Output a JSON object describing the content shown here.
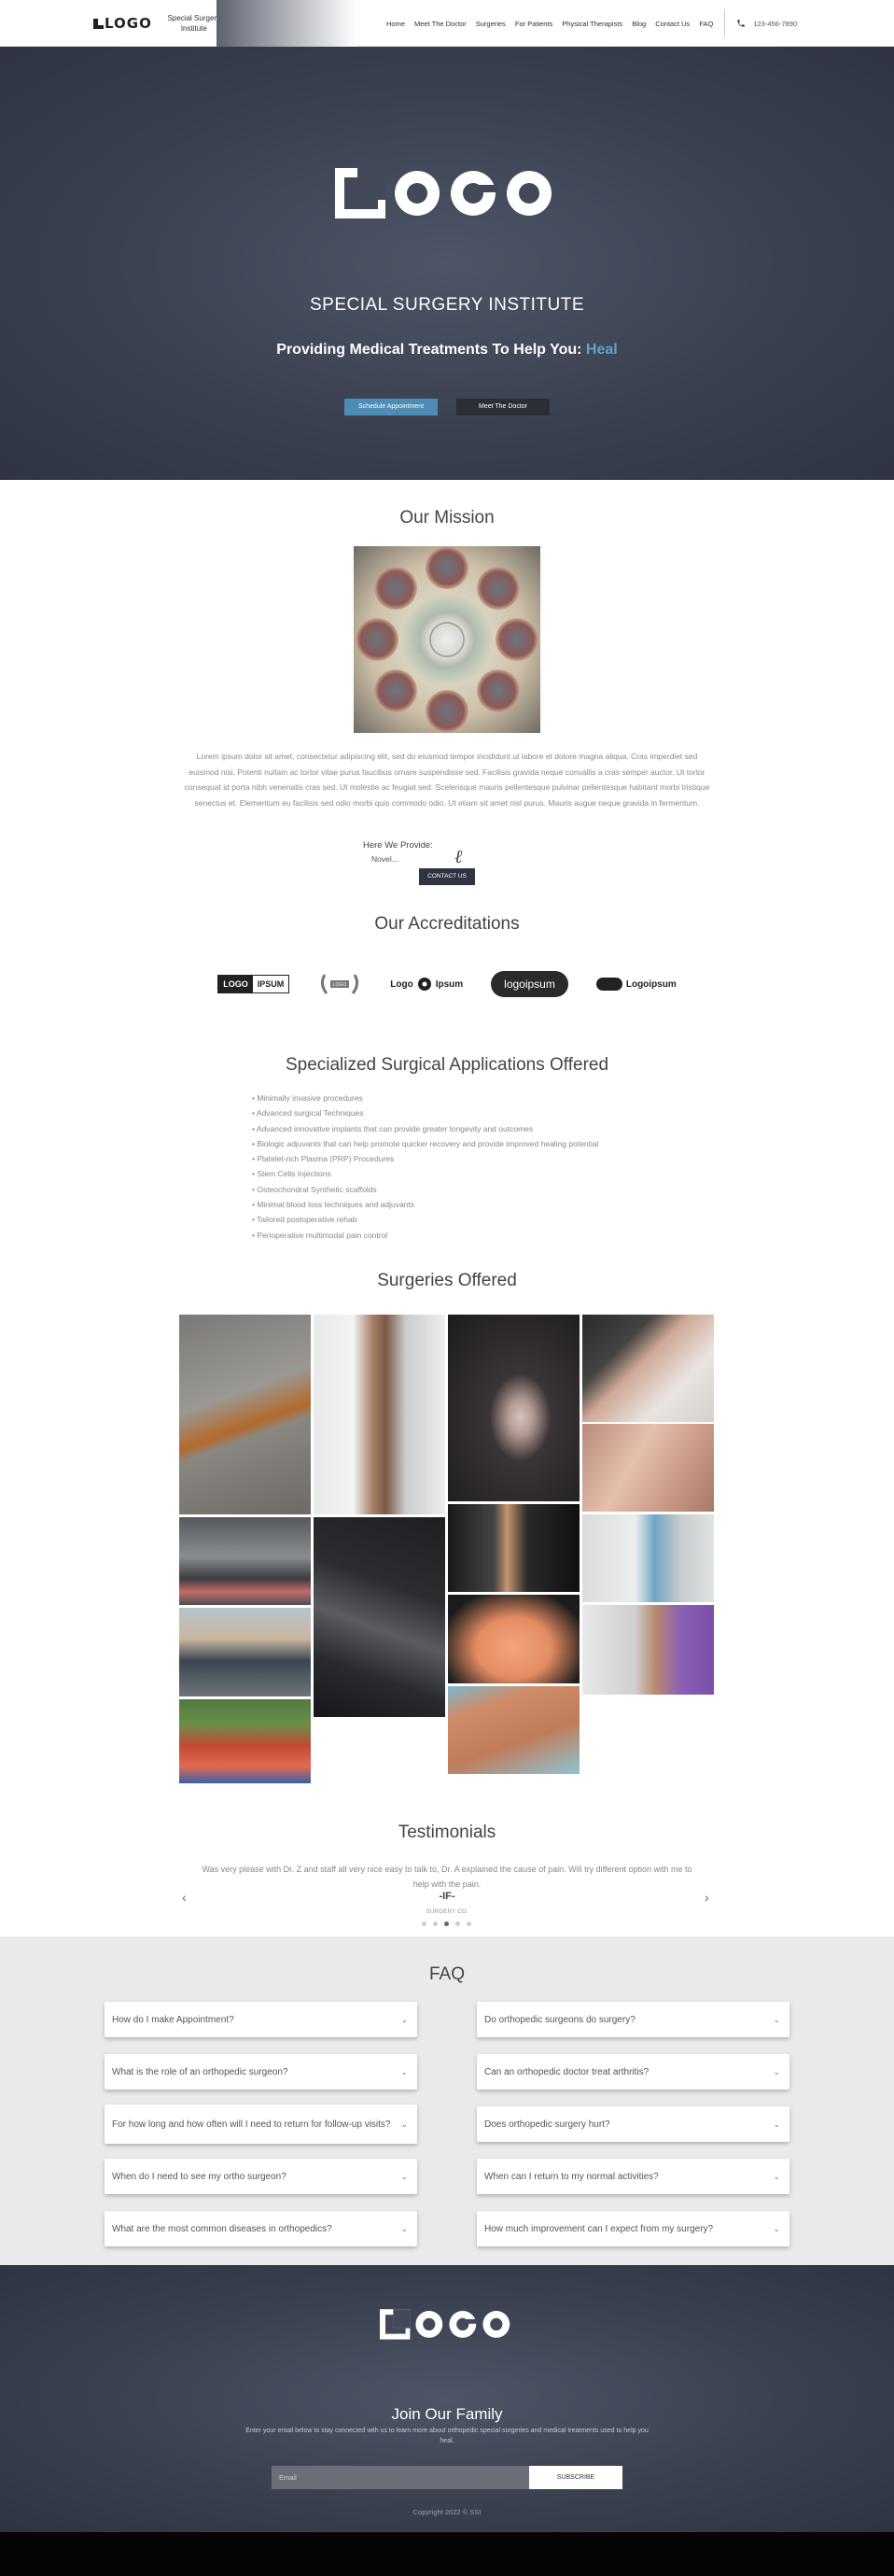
{
  "header": {
    "logo": "LOGO",
    "site_title": "Special Surgery Institute",
    "nav": [
      "Home",
      "Meet The Doctor",
      "Surgeries",
      "For Patients",
      "Physical Therapists",
      "Blog",
      "Contact Us",
      "FAQ"
    ],
    "phone": "123-456-7890"
  },
  "hero": {
    "logo": "LOGO",
    "title": "SPECIAL SURGERY INSTITUTE",
    "subtitle": "Providing Medical Treatments To Help You:",
    "highlight": "Heal",
    "btn_primary": "Schedule Appointment",
    "btn_secondary": "Meet The Doctor"
  },
  "mission": {
    "title": "Our Mission",
    "body": "Lorem ipsum dolor sit amet, consectetur adipiscing elit, sed do eiusmod tempor incididunt ut labore et dolore magna aliqua. Cras imperdiet sed euismod nisi. Potenti nullam ac tortor vitae purus faucibus ornare suspendisse sed. Facilisis gravida neque convallis a cras semper auctor. Ut tortor consequat id porta nibh venenatis cras sed. Ut molestie ac feugiat sed. Scelerisque mauris pellentesque pulvinar pellentesque habitant morbi tristique senectus et. Elementum eu facilisis sed odio morbi quis commodo odio. Ut etiam sit amet nisl purus. Mauris augue neque gravida in fermentum.",
    "provide_label": "Here We Provide:",
    "provide_value": "Novel...",
    "contact_btn": "CONTACT US"
  },
  "accreditations": {
    "title": "Our Accreditations",
    "logos": [
      "LOGO IPSUM",
      "logo",
      "Logo Ipsum",
      "logoipsum",
      "Logoipsum"
    ]
  },
  "specialized": {
    "title": "Specialized Surgical Applications Offered",
    "items": [
      "• Minimally invasive procedures",
      "• Advanced surgical Techniques",
      "• Advanced innovative implants that can provide greater longevity and outcomes",
      "• Biologic adjuvants that can help promote quicker recovery and provide improved healing potential",
      "• Platelet-rich Plasma (PRP) Procedures",
      "• Stem Cells Injections",
      "• Osteochondral Synthetic scaffolds",
      "• Minimal blood loss techniques and adjuvants",
      "• Tailored postoperative rehab",
      "• Perioperative multimodal pain control"
    ]
  },
  "surgeries": {
    "title": "Surgeries Offered"
  },
  "testimonials": {
    "title": "Testimonials",
    "quote": "Was very please with Dr. Z and staff all very nice easy to talk to, Dr. A explained the cause of pain. Will try different option with me to help with the pain.",
    "name": "-IF-",
    "role": "SURGERY CO.",
    "prev": "‹",
    "next": "›"
  },
  "faq": {
    "title": "FAQ",
    "left": [
      "How do I make Appointment?",
      "What is the role of an orthopedic surgeon?",
      "For how long and how often will I need to return for follow-up visits?",
      "When do I need to see my ortho surgeon?",
      "What are the most common diseases in orthopedics?"
    ],
    "right": [
      "Do orthopedic surgeons do surgery?",
      "Can an orthopedic doctor treat arthritis?",
      "Does orthopedic surgery hurt?",
      "When can I return to my normal activities?",
      "How much improvement can I expect from my surgery?"
    ],
    "chevron": "⌄"
  },
  "footer": {
    "logo": "LOGO",
    "join_title": "Join Our Family",
    "join_text": "Enter your email below to stay connected with us to learn more about orthopedic special surgeries and medical treatments used to help you heal.",
    "email_placeholder": "Email",
    "subscribe": "SUBSCRIBE",
    "copyright": "Copyright 2022 © SSI"
  }
}
